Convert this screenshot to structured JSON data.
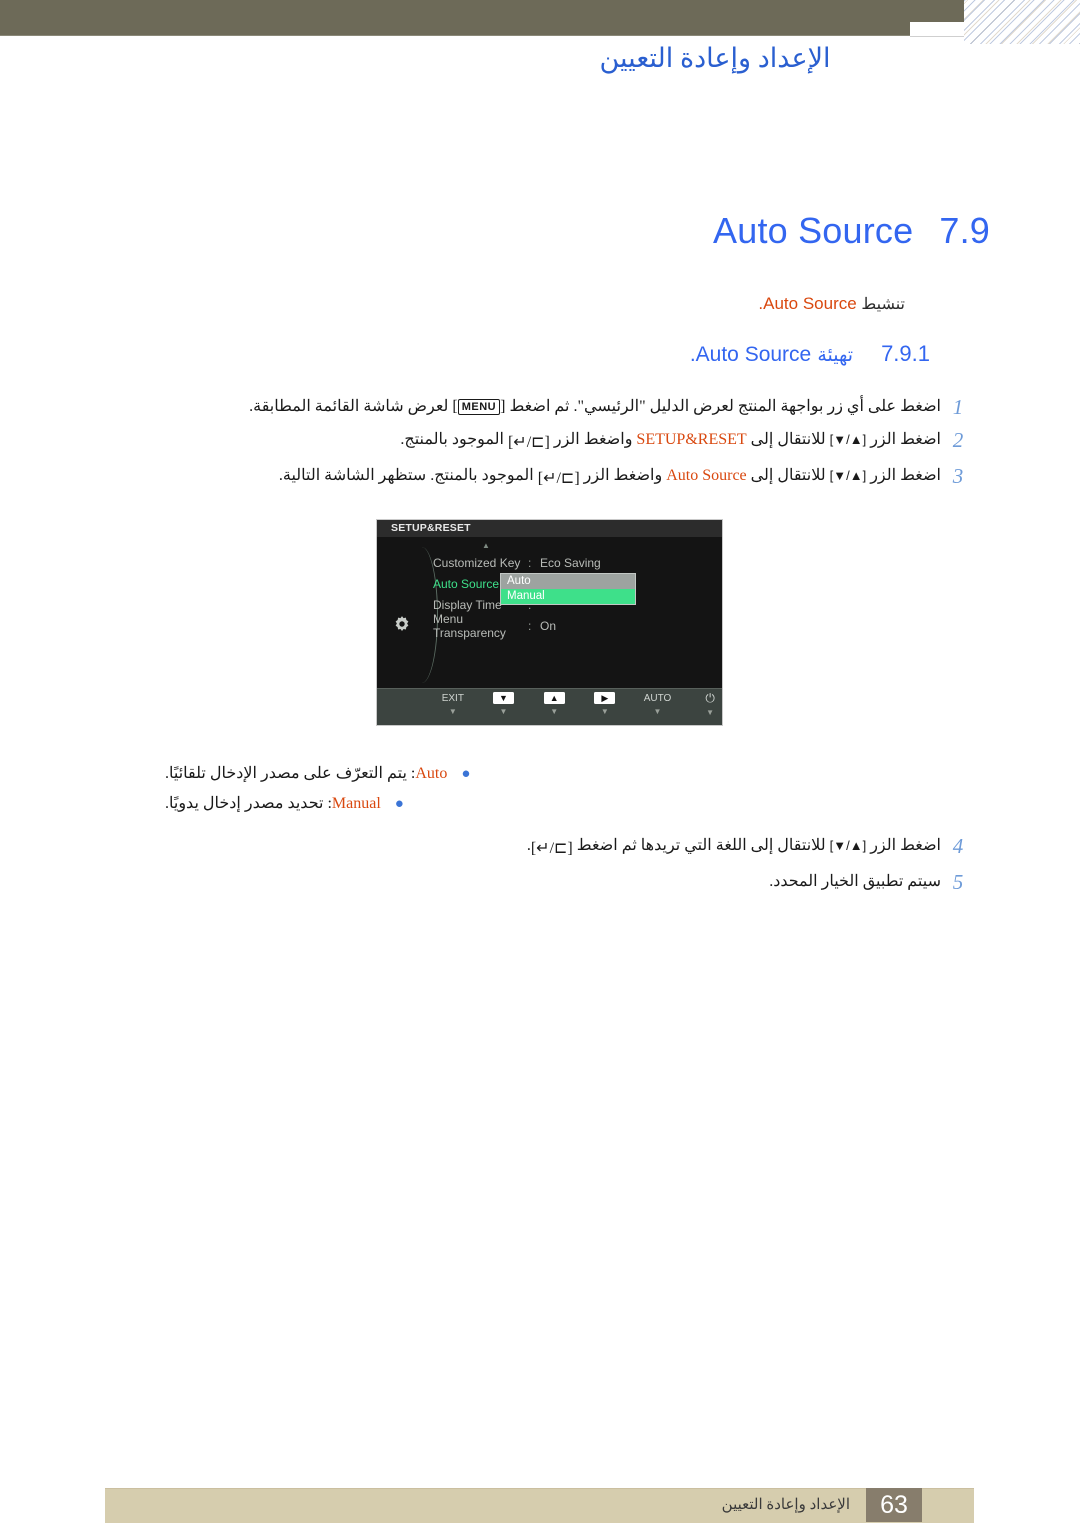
{
  "header": {
    "title": "الإعداد وإعادة التعيين"
  },
  "chapter": {
    "number": "7.9",
    "name": "Auto Source"
  },
  "activate": {
    "arabic": "تنشيط",
    "keyword": "Auto Source",
    "period": "."
  },
  "subsection": {
    "number": "7.9.1",
    "arabic": "تهيئة",
    "name": "Auto Source",
    "period": "."
  },
  "steps": [
    {
      "num": "1",
      "parts": [
        {
          "type": "text",
          "value": "اضغط على أي زر بواجهة المنتج لعرض الدليل \"الرئيسي\". ثم اضغط "
        },
        {
          "type": "keycap",
          "value": "MENU"
        },
        {
          "type": "text",
          "value": " لعرض شاشة القائمة المطابقة."
        }
      ]
    },
    {
      "num": "2",
      "parts": [
        {
          "type": "text",
          "value": "اضغط الزر "
        },
        {
          "type": "arrows",
          "value": "[▲/▼]"
        },
        {
          "type": "text",
          "value": " للانتقال إلى "
        },
        {
          "type": "kw",
          "value": "SETUP&RESET"
        },
        {
          "type": "text",
          "value": " واضغط الزر "
        },
        {
          "type": "btn",
          "value": "[⊐/↵]"
        },
        {
          "type": "text",
          "value": " الموجود بالمنتج."
        }
      ]
    },
    {
      "num": "3",
      "parts": [
        {
          "type": "text",
          "value": "اضغط الزر "
        },
        {
          "type": "arrows",
          "value": "[▲/▼]"
        },
        {
          "type": "text",
          "value": " للانتقال إلى "
        },
        {
          "type": "kw",
          "value": "Auto Source"
        },
        {
          "type": "text",
          "value": " واضغط الزر "
        },
        {
          "type": "btn",
          "value": "[⊐/↵]"
        },
        {
          "type": "text",
          "value": " الموجود بالمنتج. ستظهر الشاشة التالية."
        }
      ]
    }
  ],
  "osd": {
    "title": "SETUP&RESET",
    "rows": [
      {
        "label": "Customized Key",
        "colon": ":",
        "value": "Eco Saving",
        "selected": false
      },
      {
        "label": "Auto Source",
        "colon": ":",
        "value": "",
        "selected": true
      },
      {
        "label": "Display Time",
        "colon": ":",
        "value": "",
        "selected": false
      },
      {
        "label": "Menu Transparency",
        "colon": ":",
        "value": "On",
        "selected": false
      }
    ],
    "popup": {
      "option_auto": "Auto",
      "option_manual": "Manual"
    },
    "keys": [
      {
        "label": "EXIT",
        "boxed": false,
        "caret": "▼"
      },
      {
        "label": "▼",
        "boxed": true,
        "caret": "▼"
      },
      {
        "label": "▲",
        "boxed": true,
        "caret": "▼"
      },
      {
        "label": "▶",
        "boxed": true,
        "caret": "▼"
      },
      {
        "label": "AUTO",
        "boxed": false,
        "caret": "▼"
      },
      {
        "label": "⏻",
        "boxed": false,
        "caret": "▼"
      }
    ]
  },
  "bullets": [
    {
      "dot": "●",
      "keyword": "Auto",
      "text": ": يتم التعرّف على مصدر الإدخال تلقائيًا."
    },
    {
      "dot": "●",
      "keyword": "Manual",
      "text": ": تحديد مصدر إدخال يدويًا."
    }
  ],
  "steps2": [
    {
      "num": "4",
      "parts": [
        {
          "type": "text",
          "value": "اضغط الزر "
        },
        {
          "type": "arrows",
          "value": "[▲/▼]"
        },
        {
          "type": "text",
          "value": " للانتقال إلى اللغة التي تريدها ثم اضغط "
        },
        {
          "type": "btn",
          "value": "[⊐/↵]"
        },
        {
          "type": "text",
          "value": "."
        }
      ]
    },
    {
      "num": "5",
      "parts": [
        {
          "type": "text",
          "value": "سيتم تطبيق الخيار المحدد."
        }
      ]
    }
  ],
  "footer": {
    "text": "الإعداد وإعادة التعيين",
    "page": "63"
  },
  "colors": {
    "header_bar": "#6d6a58",
    "heading_blue": "#3366f0",
    "keyword_orange": "#d9480f",
    "step_number": "#6e9bd8",
    "osd_green": "#3ee08a",
    "footer_bar": "#d6cdae",
    "footer_page": "#877d6c"
  }
}
